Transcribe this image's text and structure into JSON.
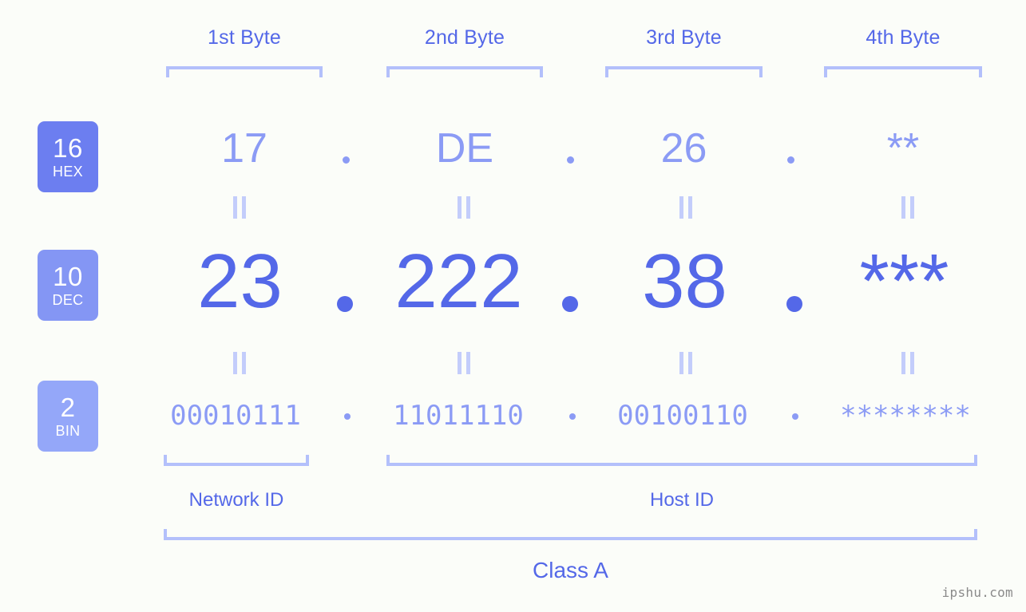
{
  "meta": {
    "watermark": "ipshu.com",
    "background_color": "#fbfdf9",
    "accent_strong": "#5468e8",
    "accent_light": "#8b9bf5",
    "bracket_color": "#b3c0fb"
  },
  "byte_headers": [
    {
      "label": "1st Byte"
    },
    {
      "label": "2nd Byte"
    },
    {
      "label": "3rd Byte"
    },
    {
      "label": "4th Byte"
    }
  ],
  "radix_badges": [
    {
      "number": "16",
      "name": "HEX",
      "color": "#6c7ef0"
    },
    {
      "number": "10",
      "name": "DEC",
      "color": "#8496f4"
    },
    {
      "number": "2",
      "name": "BIN",
      "color": "#94a7f9"
    }
  ],
  "rows": {
    "hex": {
      "values": [
        "17",
        "DE",
        "26",
        "**"
      ],
      "separator": "."
    },
    "dec": {
      "values": [
        "23",
        "222",
        "38",
        "***"
      ],
      "separator": "."
    },
    "bin": {
      "values": [
        "00010111",
        "11011110",
        "00100110",
        "********"
      ],
      "separator": "."
    }
  },
  "separators": {
    "equals_symbol": "="
  },
  "sections": [
    {
      "label": "Network ID"
    },
    {
      "label": "Host ID"
    }
  ],
  "ip_class": {
    "label": "Class A"
  }
}
